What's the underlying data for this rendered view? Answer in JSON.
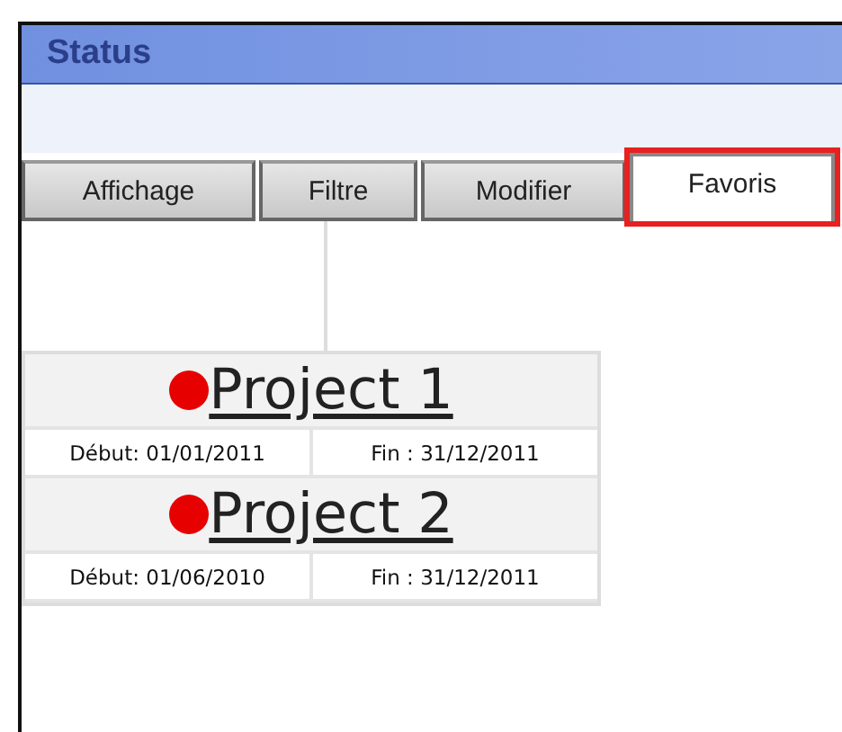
{
  "window": {
    "title": "Status"
  },
  "tabs": [
    {
      "label": "Affichage",
      "selected": false,
      "highlighted": false
    },
    {
      "label": "Filtre",
      "selected": false,
      "highlighted": false
    },
    {
      "label": "Modifier",
      "selected": false,
      "highlighted": false
    },
    {
      "label": "Favoris",
      "selected": true,
      "highlighted": true
    }
  ],
  "projects": [
    {
      "name": "Project 1",
      "start": "Début: 01/01/2011",
      "end": "Fin : 31/12/2011"
    },
    {
      "name": "Project 2",
      "start": "Début: 01/06/2010",
      "end": "Fin : 31/12/2011"
    }
  ]
}
